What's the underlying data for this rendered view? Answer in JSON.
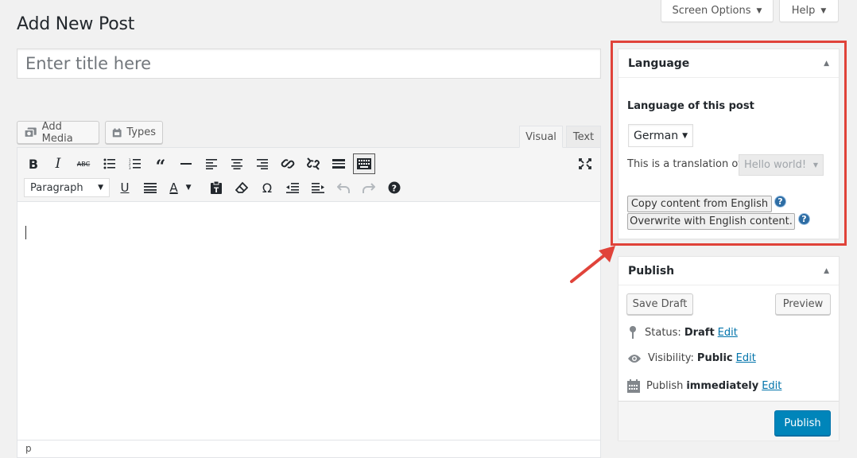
{
  "header": {
    "screen_options": "Screen Options",
    "help": "Help",
    "page_title": "Add New Post"
  },
  "title_field": {
    "placeholder": "Enter title here",
    "value": ""
  },
  "media": {
    "add_media": "Add Media",
    "types": "Types"
  },
  "editor_tabs": {
    "visual": "Visual",
    "text": "Text",
    "active": "Visual"
  },
  "toolbar": {
    "row1": [
      "bold-icon",
      "italic-icon",
      "strikethrough-icon",
      "bullet-list-icon",
      "numbered-list-icon",
      "blockquote-icon",
      "horizontal-line-icon",
      "align-left-icon",
      "align-center-icon",
      "align-right-icon",
      "link-icon",
      "unlink-icon",
      "read-more-icon",
      "toolbar-toggle-icon"
    ],
    "row2": [
      "underline-icon",
      "justify-icon",
      "text-color-icon",
      "paste-as-text-icon",
      "clear-formatting-icon",
      "special-character-icon",
      "outdent-icon",
      "indent-icon",
      "undo-icon",
      "redo-icon",
      "keyboard-shortcuts-icon"
    ],
    "format_select": "Paragraph",
    "bold": "B",
    "italic": "I",
    "strike": "ABC",
    "underline": "U",
    "text_color": "A",
    "omega": "Ω"
  },
  "editor_status": {
    "path": "p"
  },
  "language_box": {
    "title": "Language",
    "label": "Language of this post",
    "selected_language": "German",
    "translation_label": "This is a translation of",
    "translation_value": "Hello world!",
    "copy_button": "Copy content from English",
    "overwrite_button": "Overwrite with English content.",
    "help": "?"
  },
  "publish_box": {
    "title": "Publish",
    "save_draft": "Save Draft",
    "preview": "Preview",
    "status_label": "Status:",
    "status_value": "Draft",
    "visibility_label": "Visibility:",
    "visibility_value": "Public",
    "publish_label": "Publish",
    "publish_value": "immediately",
    "edit": "Edit",
    "publish_button": "Publish"
  },
  "colors": {
    "highlight": "#e0433a",
    "primary": "#0085ba",
    "link": "#0073aa"
  }
}
